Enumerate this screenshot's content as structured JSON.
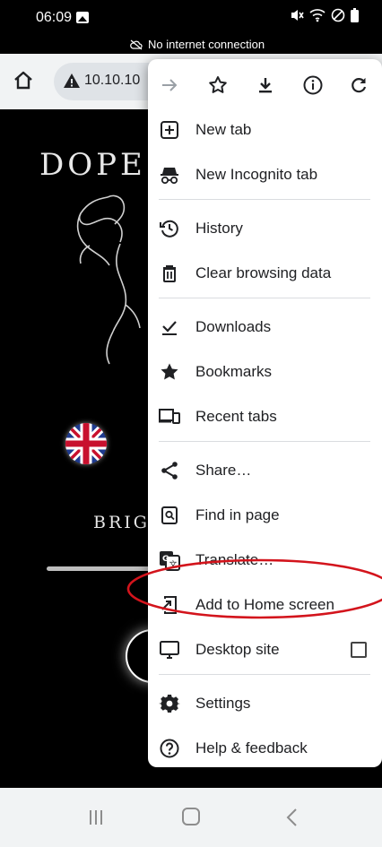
{
  "status_bar": {
    "time": "06:09",
    "network_notice": "No internet connection"
  },
  "toolbar": {
    "url": "10.10.10"
  },
  "website": {
    "title": "DOPE",
    "subtitle": "BRIG"
  },
  "menu": {
    "top_actions": [
      "forward-icon",
      "bookmark-star-icon",
      "download-icon",
      "info-icon",
      "refresh-icon"
    ],
    "items": [
      {
        "label": "New tab",
        "icon": "new-tab-icon"
      },
      {
        "label": "New Incognito tab",
        "icon": "incognito-icon"
      },
      {
        "label": "History",
        "icon": "history-icon"
      },
      {
        "label": "Clear browsing data",
        "icon": "trash-icon"
      },
      {
        "label": "Downloads",
        "icon": "downloads-icon"
      },
      {
        "label": "Bookmarks",
        "icon": "star-icon"
      },
      {
        "label": "Recent tabs",
        "icon": "devices-icon"
      },
      {
        "label": "Share…",
        "icon": "share-icon"
      },
      {
        "label": "Find in page",
        "icon": "find-icon"
      },
      {
        "label": "Translate…",
        "icon": "translate-icon"
      },
      {
        "label": "Add to Home screen",
        "icon": "add-to-home-icon"
      },
      {
        "label": "Desktop site",
        "icon": "desktop-icon",
        "checked": false
      },
      {
        "label": "Settings",
        "icon": "gear-icon"
      },
      {
        "label": "Help & feedback",
        "icon": "help-icon"
      }
    ]
  },
  "colors": {
    "annotation": "#d3141c",
    "menu_background": "#ffffff",
    "toolbar_background": "#f1f3f4"
  }
}
